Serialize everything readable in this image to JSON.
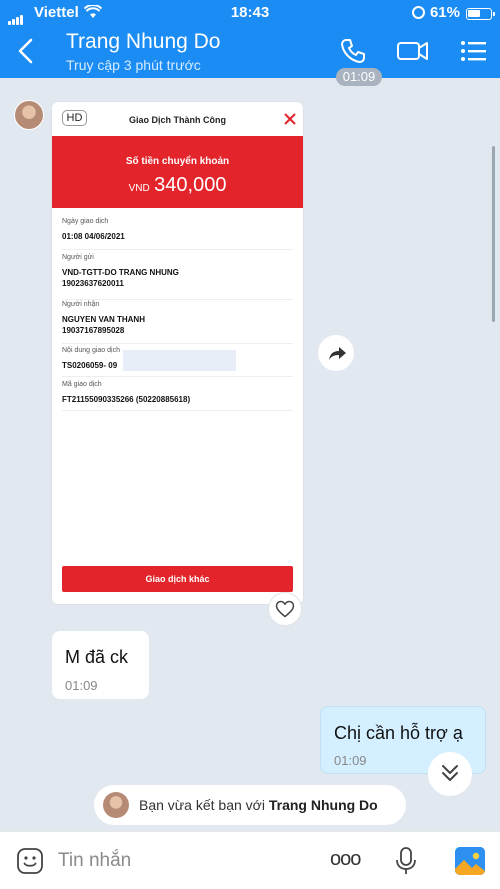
{
  "status_bar": {
    "carrier": "Viettel",
    "time": "18:43",
    "battery": "61%",
    "battery_level": 0.61
  },
  "header": {
    "contact_name": "Trang Nhung Do",
    "last_seen": "Truy cập 3 phút trước",
    "accent_color": "#1a8cf3"
  },
  "chat": {
    "top_time_chip": "01:09",
    "receipt": {
      "badge": "HD",
      "title": "Giao Dịch Thành Công",
      "amount_label": "Số tiền chuyển khoản",
      "currency": "VND",
      "amount": "340,000",
      "rows": [
        {
          "label": "Ngày giao dịch",
          "value": "01:08 04/06/2021"
        },
        {
          "label": "Người gửi",
          "value": "VND-TGTT-DO TRANG NHUNG",
          "value2": "19023637620011"
        },
        {
          "label": "Người nhận",
          "value": "NGUYEN VAN THANH",
          "value2": "19037167895028"
        },
        {
          "label": "Nội dung giao dịch",
          "value": "TS0206059- 09"
        },
        {
          "label": "Mã giao dịch",
          "value": "FT21155090335266 (50220885618)"
        }
      ],
      "button": "Giao dịch khác",
      "brand_color": "#e3242b"
    },
    "incoming_message": {
      "text": "M đã ck",
      "time": "01:09"
    },
    "outgoing_message": {
      "text": "Chị cần hỗ trợ ạ",
      "time": "01:09"
    },
    "friend_notice": {
      "prefix": "Bạn vừa kết bạn với",
      "name": "Trang Nhung Do"
    }
  },
  "composer": {
    "placeholder": "Tin nhắn",
    "more": "ooo"
  },
  "icons": [
    "back-icon",
    "phone-icon",
    "video-icon",
    "list-icon",
    "close-icon",
    "share-icon",
    "heart-icon",
    "chevron-down-icon",
    "emoji-icon",
    "mic-icon",
    "image-icon"
  ]
}
